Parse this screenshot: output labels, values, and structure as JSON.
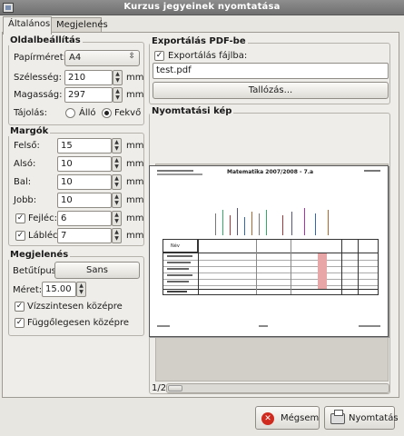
{
  "window": {
    "title": "Kurzus jegyeinek nyomtatása"
  },
  "tabs": [
    {
      "label": "Általános"
    },
    {
      "label": "Megjelenés"
    }
  ],
  "page_settings": {
    "title": "Oldalbeállítás",
    "paper_size_label": "Papírméret:",
    "paper_size_value": "A4",
    "width_label": "Szélesség:",
    "width_value": "210",
    "height_label": "Magasság:",
    "height_value": "297",
    "unit": "mm",
    "orientation_label": "Tájolás:",
    "portrait_label": "Álló",
    "landscape_label": "Fekvő",
    "orientation_selected": "Fekvő"
  },
  "margins": {
    "title": "Margók",
    "top_label": "Felső:",
    "top_value": "15",
    "bottom_label": "Alsó:",
    "bottom_value": "10",
    "left_label": "Bal:",
    "left_value": "10",
    "right_label": "Jobb:",
    "right_value": "10",
    "header_label": "Fejléc:",
    "header_value": "6",
    "header_checked": true,
    "footer_label": "Lábléc:",
    "footer_value": "7",
    "footer_checked": true,
    "unit": "mm"
  },
  "appearance": {
    "title": "Megjelenés",
    "font_label": "Betűtípus:",
    "font_value": "Sans",
    "size_label": "Méret:",
    "size_value": "15.00",
    "center_h_label": "Vízszintesen középre",
    "center_v_label": "Függőlegesen középre",
    "center_h_checked": true,
    "center_v_checked": true
  },
  "pdf_export": {
    "title": "Exportálás PDF-be",
    "export_label": "Exportálás fájlba:",
    "export_checked": true,
    "filename": "test.pdf",
    "browse_label": "Tallózás..."
  },
  "preview": {
    "title": "Nyomtatási kép",
    "page_indicator": "1/2",
    "doc_heading": "Matematika 2007/2008 - 7.a",
    "col_header": "Név"
  },
  "buttons": {
    "cancel": "Mégsem",
    "print": "Nyomtatás"
  },
  "colors": {
    "highlight_column": "#e8a6a6",
    "titlebar": "#7a7a7a"
  }
}
